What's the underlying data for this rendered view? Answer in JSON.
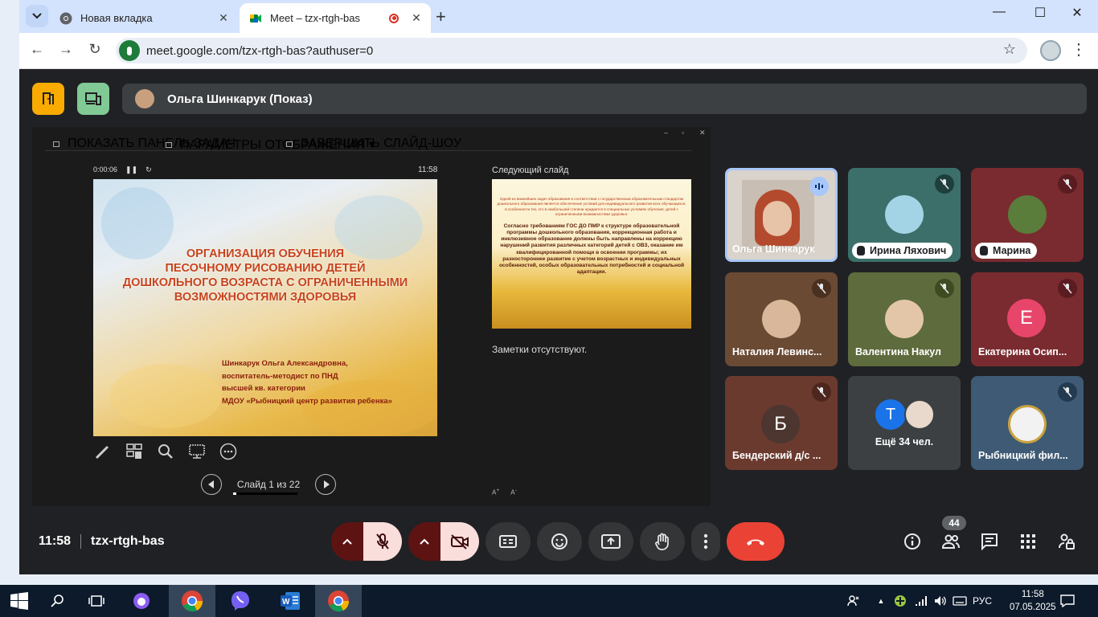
{
  "browser": {
    "tabs": [
      {
        "title": "Новая вкладка",
        "active": false
      },
      {
        "title": "Meet – tzx-rtgh-bas",
        "active": true
      }
    ],
    "url": "meet.google.com/tzx-rtgh-bas?authuser=0"
  },
  "meet": {
    "presenter_label": "Ольга Шинкарук (Показ)",
    "meeting_code": "tzx-rtgh-bas",
    "time": "11:58",
    "participants_count": "44"
  },
  "slideshow": {
    "toolbar": [
      "ПОКАЗАТЬ ПАНЕЛЬ ЗАДАЧ",
      "ПАРАМЕТРЫ ОТОБРАЖЕНИЯ ▾",
      "ЗАВЕРШИТЬ СЛАЙД-ШОУ"
    ],
    "elapsed": "0:00:06",
    "clock": "11:58",
    "slide_title": [
      "ОРГАНИЗАЦИЯ  ОБУЧЕНИЯ",
      "ПЕСОЧНОМУ  РИСОВАНИЮ ДЕТЕЙ",
      "ДОШКОЛЬНОГО ВОЗРАСТА С ОГРАНИЧЕННЫМИ",
      "ВОЗМОЖНОСТЯМИ  ЗДОРОВЬЯ"
    ],
    "slide_author": [
      "Шинкарук Ольга Александровна,",
      "воспитатель-методист по ПНД",
      "высшей кв. категории",
      "МДОУ «Рыбницкий центр развития ребенка»"
    ],
    "slide_counter": "Слайд 1 из 22",
    "progress": 0.045,
    "next_label": "Следующий слайд",
    "next_p1": "Одной из важнейших задач образования в соответствии с государственным образовательным стандартом дошкольного образования является обеспечение условий для индивидуального развития всех обучающихся, в особенности тех, кто в наибольшей степени нуждается в специальных условиях обучения, детей с ограниченными возможностями здоровья.",
    "next_p2": "Согласно требованиям ГОС ДО ПМР к структуре образовательной программы дошкольного образования, коррекционная работа и инклюзивное образование должны быть направлены на коррекцию нарушений развития различных категорий детей с ОВЗ, оказание им квалифицированной помощи в освоении программы; их разностороннее развитие с учетом возрастных и индивидуальных особенностей, особых образовательных потребностей и социальной адаптации.",
    "notes": "Заметки отсутствуют."
  },
  "participants": [
    {
      "name": "Ольга Шинкарук",
      "speaking": true
    },
    {
      "name": "Ирина Ляхович",
      "hand": true,
      "muted": true
    },
    {
      "name": "Марина",
      "hand": true,
      "muted": true
    },
    {
      "name": "Наталия Левинс...",
      "muted": true
    },
    {
      "name": "Валентина Накул",
      "muted": true
    },
    {
      "name": "Екатерина Осип...",
      "letter": "Е",
      "muted": true
    },
    {
      "name": "Бендерский д/с ...",
      "letter": "Б",
      "muted": true
    },
    {
      "name": "Ещё 34 чел.",
      "letter": "Т"
    },
    {
      "name": "Рыбницкий фил...",
      "muted": true
    }
  ],
  "taskbar": {
    "lang": "РУС",
    "time": "11:58",
    "date": "07.05.2025"
  },
  "colors": {
    "yellow": "#f9ab00",
    "green": "#81c995",
    "red": "#ea4335"
  }
}
